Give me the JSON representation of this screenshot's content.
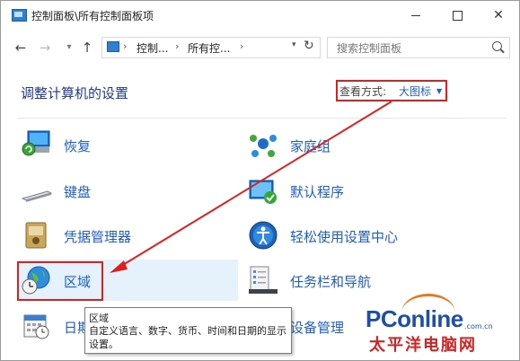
{
  "window": {
    "title": "控制面板\\所有控制面板项",
    "minimize_glyph": "—",
    "maximize_glyph": "☐",
    "close_glyph": "✕"
  },
  "nav": {
    "back_glyph": "←",
    "forward_glyph": "→",
    "recent_glyph": "▾",
    "up_glyph": "↑",
    "separator_glyph": "›",
    "breadcrumbs": [
      "控制...",
      "所有控..."
    ],
    "dropdown_glyph": "▾",
    "refresh_glyph": "↻",
    "search_placeholder": "搜索控制面板"
  },
  "header": {
    "title": "调整计算机的设置",
    "view_by_label": "查看方式:",
    "view_by_value": "大图标",
    "view_by_caret": "▼"
  },
  "items": [
    {
      "label": "恢复",
      "icon": "recovery-icon"
    },
    {
      "label": "家庭组",
      "icon": "homegroup-icon"
    },
    {
      "label": "键盘",
      "icon": "keyboard-icon"
    },
    {
      "label": "默认程序",
      "icon": "default-programs-icon"
    },
    {
      "label": "凭据管理器",
      "icon": "credential-manager-icon"
    },
    {
      "label": "轻松使用设置中心",
      "icon": "ease-of-access-icon"
    },
    {
      "label": "区域",
      "icon": "region-globe-icon"
    },
    {
      "label": "任务栏和导航",
      "icon": "taskbar-navigation-icon"
    },
    {
      "label": "日期",
      "icon": "date-time-icon"
    },
    {
      "label": "设备管理",
      "icon": "device-manager-icon"
    }
  ],
  "tooltip": {
    "title": "区域",
    "description": "自定义语言、数字、货币、时间和日期的显示设置。"
  },
  "watermark": {
    "brand": "PConline",
    "domain": ".com.cn",
    "chinese": "太平洋电脑网"
  },
  "colors": {
    "link": "#1d5fc4",
    "highlight_box": "#e01e1e",
    "hover": "#e5f1fb",
    "title": "#1e3a8a"
  }
}
